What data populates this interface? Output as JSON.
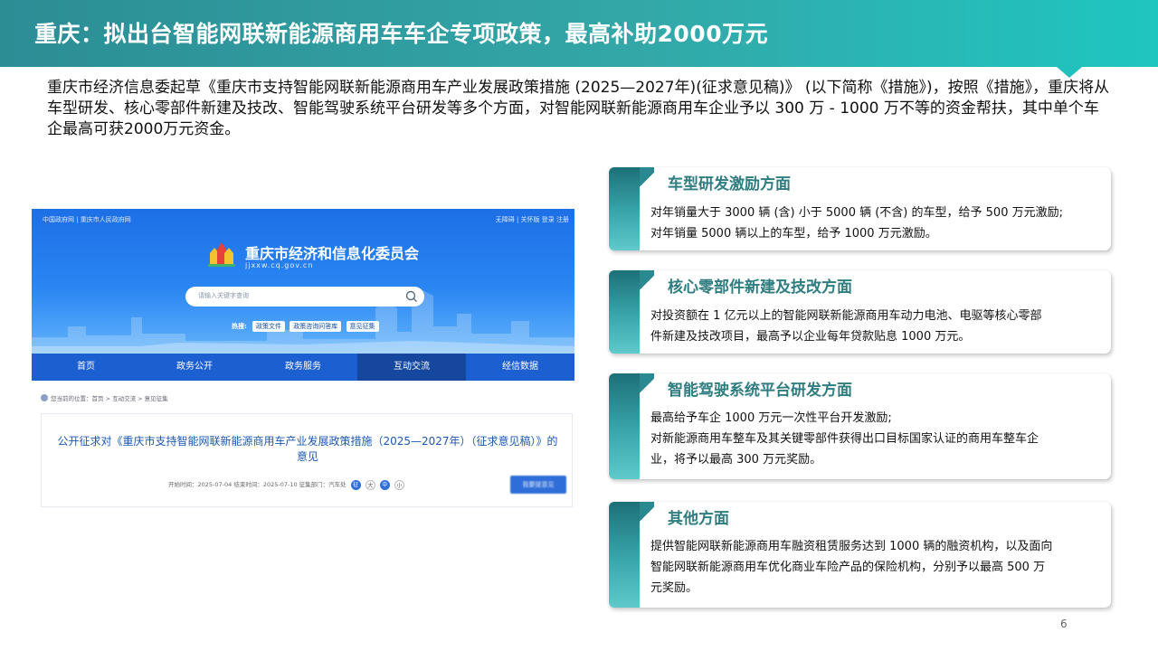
{
  "header": {
    "title": "重庆：拟出台智能网联新能源商用车车企专项政策，最高补助2000万元"
  },
  "intro": "重庆市经济信息委起草《重庆市支持智能网联新能源商用车产业发展政策措施 (2025—2027年)(征求意见稿)》 (以下简称《措施》)，按照《措施》，重庆将从车型研发、核心零部件新建及技改、智能驾驶系统平台研发等多个方面，对智能网联新能源商用车企业予以 300 万 - 1000 万不等的资金帮扶，其中单个车企最高可获2000万元资金。",
  "screenshot": {
    "top_links": "中国政府网 | 重庆市人民政府网",
    "top_right": "无障碍  |  关怀版  登录  注册",
    "site_title": "重庆市经济和信息化委员会",
    "site_url": "jjxxw.cq.gov.cn",
    "search_placeholder": "请输入关键字查询",
    "hot_label": "热搜:",
    "hot_tags": [
      "政策文件",
      "政策咨询问答库",
      "意见征集"
    ],
    "nav": [
      "首页",
      "政务公开",
      "政务服务",
      "互动交流",
      "经信数据"
    ],
    "breadcrumb": "您当前的位置：首页 > 互动交流 > 意见征集",
    "notice_title": "公开征求对《重庆市支持智能网联新能源商用车产业发展政策措施（2025—2027年）（征求意见稿）》的意见",
    "meta": "开始时间：2025-07-04    结束时间：2025-07-10    征集部门：汽车处",
    "meta_badges": [
      "征",
      "大",
      "中",
      "小"
    ],
    "button": "我要提意见"
  },
  "sections": [
    {
      "title": "车型研发激励方面",
      "lines": [
        "对年销量大于 3000 辆 (含) 小于 5000 辆 (不含) 的车型，给予 500 万元激励;",
        "对年销量 5000 辆以上的车型，给予 1000 万元激励。"
      ]
    },
    {
      "title": "核心零部件新建及技改方面",
      "lines": [
        "对投资额在 1 亿元以上的智能网联新能源商用车动力电池、电驱等核心零部",
        "件新建及技改项目，最高予以企业每年贷款贴息 1000 万元。"
      ]
    },
    {
      "title": "智能驾驶系统平台研发方面",
      "lines": [
        "最高给予车企 1000 万元一次性平台开发激励;",
        "对新能源商用车整车及其关键零部件获得出口目标国家认证的商用车整车企",
        "业，将予以最高 300 万元奖励。"
      ]
    },
    {
      "title": "其他方面",
      "lines": [
        "提供智能网联新能源商用车融资租赁服务达到 1000 辆的融资机构，以及面向",
        "智能网联新能源商用车优化商业车险产品的保险机构，分别予以最高 500 万",
        "元奖励。"
      ]
    }
  ],
  "page_number": "6",
  "colors": {
    "header_start": "#2c8d95",
    "header_end": "#1fc6c0",
    "section_title": "#2f7d80",
    "site_blue": "#1b5fd1"
  }
}
